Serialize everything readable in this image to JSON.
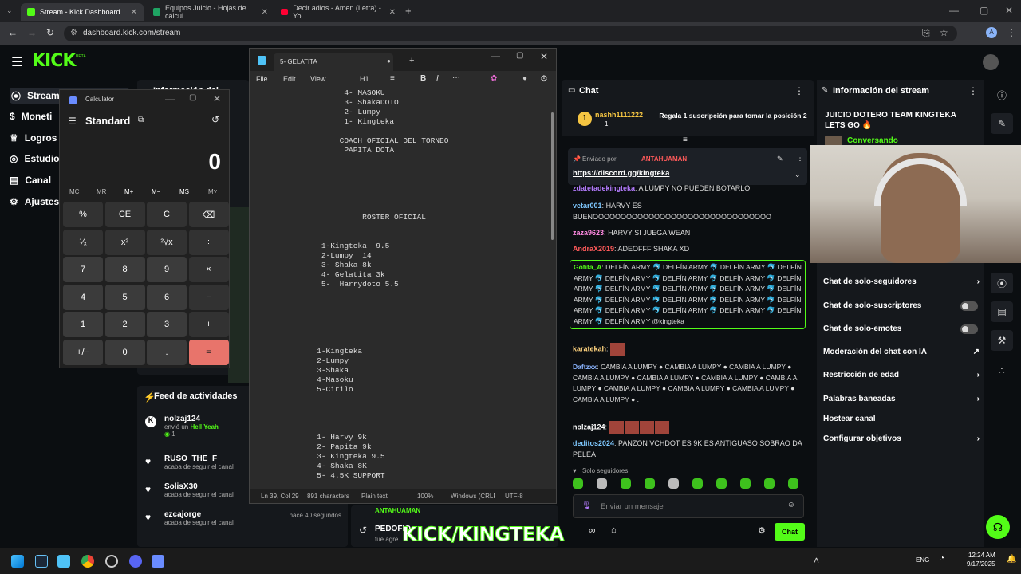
{
  "browser": {
    "tabs": [
      {
        "title": "Stream - Kick Dashboard",
        "icon": "kick-icon",
        "color": "#53fc18"
      },
      {
        "title": "Equipos Juicio - Hojas de cálcul",
        "icon": "sheets-icon",
        "color": "#1fa463"
      },
      {
        "title": "Decir adios - Amen (Letra) - Yo",
        "icon": "youtube-icon",
        "color": "#ff0033"
      }
    ],
    "url": "dashboard.kick.com/stream"
  },
  "kick": {
    "logo": "KICK",
    "beta": "BETA",
    "sidebar": [
      "Stream",
      "Moneti",
      "Logros",
      "Estudio",
      "Canal",
      "Ajustes"
    ]
  },
  "calculator": {
    "title": "Calculator",
    "mode": "Standard",
    "display": "0",
    "memory": [
      "MC",
      "MR",
      "M+",
      "M−",
      "MS",
      "M˅"
    ],
    "rows": [
      [
        "%",
        "CE",
        "C",
        "⌫"
      ],
      [
        "¹⁄ₓ",
        "x²",
        "²√x",
        "÷"
      ],
      [
        "7",
        "8",
        "9",
        "×"
      ],
      [
        "4",
        "5",
        "6",
        "−"
      ],
      [
        "1",
        "2",
        "3",
        "+"
      ],
      [
        "+/−",
        "0",
        ".",
        "="
      ]
    ]
  },
  "notepad": {
    "tab_title": "5- GELATITA",
    "menu": [
      "File",
      "Edit",
      "View"
    ],
    "heading": "H1",
    "content": "                   4- MASOKU\n                   3- ShakaDOTO\n                   2- Lumpy\n                   1- Kingteka\n\n                  COACH OFICIAL DEL TORNEO\n                   PAPITA DOTA\n\n\n\n\n\n\n                       ROSTER OFICIAL\n\n\n              1-Kingteka  9.5\n              2-Lumpy  14\n              3- Shaka 8k\n              4- Gelatita 3k\n              5-  Harrydoto 5.5\n\n\n\n\n\n\n             1-Kingteka\n             2-Lumpy\n             3-Shaka\n             4-Masoku\n             5-Cirilo\n\n\n\n\n             1- Harvy 9k\n             2- Papita 9k\n             3- Kingteka 9.5\n             4- Shaka 8K\n             5- 4.5K SUPPORT",
    "status": [
      "Ln 39, Col 29",
      "891 characters",
      "Plain text",
      "100%",
      "Windows (CRLF)",
      "UTF-8"
    ]
  },
  "left_panels": {
    "info_title": "Información del stream",
    "feed_title": "Feed de actividades",
    "feed": [
      {
        "user": "nolzaj124",
        "text": "envió un",
        "highlight": "Hell Yeah",
        "count": "1",
        "time": ""
      },
      {
        "user": "RUSO_THE_F",
        "text": "acaba de seguir el canal",
        "time": ""
      },
      {
        "user": "SolisX30",
        "text": "acaba de seguir el canal",
        "time": ""
      },
      {
        "user": "ezcajorge",
        "text": "acaba de seguir el canal",
        "time": "hace 40 segundos"
      }
    ],
    "bottom_user": "ANTAHUAMAN",
    "bottom_user2": "PEDOFIO",
    "bottom_text": "fue agre"
  },
  "chat": {
    "title": "Chat",
    "gift_user": "nashh1111222",
    "gift_count": "1",
    "gift_text": "Regala 1 suscripción para tomar la posición 2",
    "pinned_by": "Enviado por",
    "pinned_user": "ANTAHUAMAN",
    "pinned_link": "https://discord.gg/kingteka",
    "messages": [
      {
        "user": "zdatetadekingteka",
        "color": "#b57cff",
        "text": "A LUMPY NO PUEDEN BOTARLO"
      },
      {
        "user": "vetar001",
        "color": "#7ec8ff",
        "text": "HARVY ES BUENOOOOOOOOOOOOOOOOOOOOOOOOOOOOOOOO"
      },
      {
        "user": "zaza9623",
        "color": "#ff8ae2",
        "text": "HARVY SI JUEGA WEAN"
      },
      {
        "user": "AndraX2019",
        "color": "#ff5a5a",
        "text": "ADEOFFF SHAKA XD"
      },
      {
        "user": "Gotita_A",
        "color": "#53fc18",
        "text": "DELFÍN ARMY 🐬 DELFÍN ARMY 🐬 DELFÍN ARMY 🐬 DELFÍN ARMY 🐬 DELFÍN ARMY 🐬 DELFÍN ARMY 🐬 DELFÍN ARMY 🐬 DELFÍN ARMY 🐬 DELFÍN ARMY 🐬 DELFÍN ARMY 🐬 DELFÍN ARMY 🐬 DELFÍN ARMY 🐬 DELFÍN ARMY 🐬 DELFÍN ARMY 🐬 DELFÍN ARMY 🐬 DELFÍN ARMY 🐬 DELFÍN ARMY 🐬 DELFÍN ARMY 🐬 DELFÍN ARMY 🐬 DELFÍN ARMY 🐬 DELFÍN ARMY @kingteka"
      },
      {
        "user": "karatekah",
        "color": "#ffd37e",
        "text": ""
      },
      {
        "user": "Daftzxx",
        "color": "#8ab4ff",
        "text": "CAMBIA A LUMPY ● CAMBIA A LUMPY ● CAMBIA A LUMPY ● CAMBIA A LUMPY ● CAMBIA A LUMPY ● CAMBIA A LUMPY ● CAMBIA A LUMPY ● CAMBIA A LUMPY ● CAMBIA A LUMPY ● CAMBIA A LUMPY ● CAMBIA A LUMPY ● ."
      },
      {
        "user": "nolzaj124",
        "color": "#ffffff",
        "text": ""
      },
      {
        "user": "deditos2024",
        "color": "#7ec8ff",
        "text": "PANZON VCHDOT ES 9K ES ANTIGUASO SOBRAO DA PELEA"
      }
    ],
    "followers_only": "Solo seguidores",
    "input_placeholder": "Enviar un mensaje",
    "send": "Chat"
  },
  "stream_info": {
    "title": "Información del stream",
    "stream_title": "JUICIO DOTERO TEAM KINGTEKA LETS GO 🔥",
    "category": "Conversando",
    "items": [
      "Chat de solo-seguidores",
      "Chat de solo-suscriptores",
      "Chat de solo-emotes",
      "Moderación del chat con IA",
      "Restricción de edad",
      "Palabras baneadas",
      "Hostear canal",
      "Configurar objetivos"
    ]
  },
  "overlay": {
    "text": "KICK/KINGTEKA"
  },
  "taskbar": {
    "lang": "ENG",
    "time": "12:24 AM",
    "date": "9/17/2025"
  }
}
